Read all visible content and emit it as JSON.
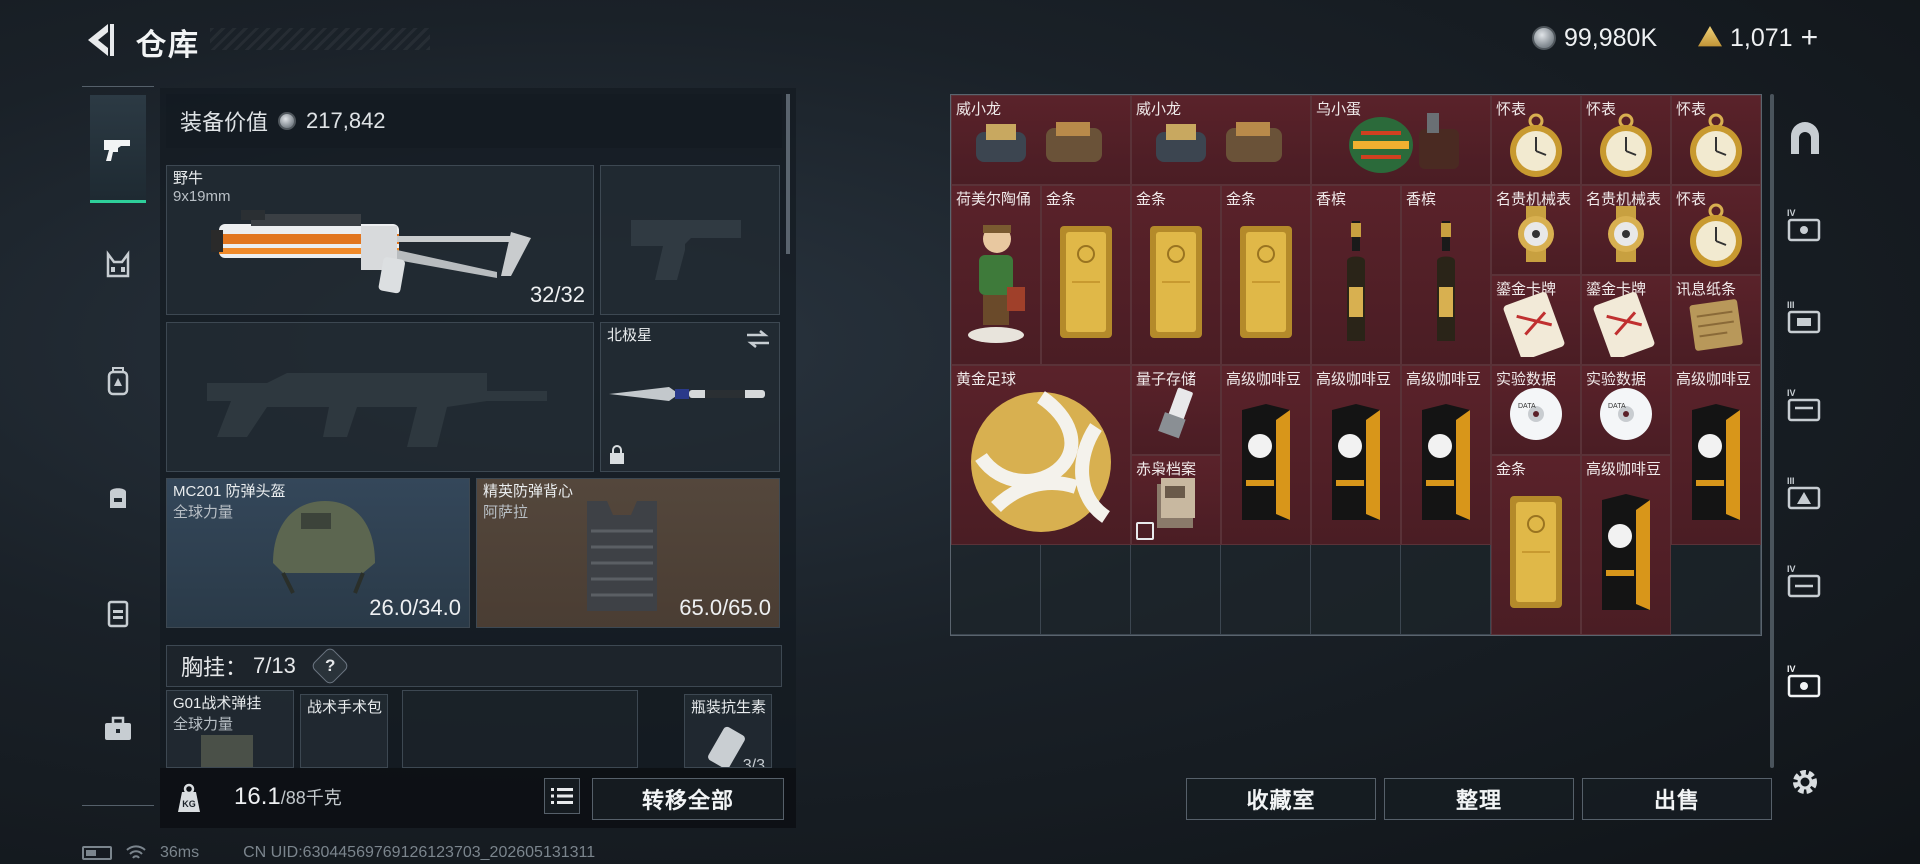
{
  "header": {
    "title": "仓库",
    "currency_silver": "99,980K",
    "currency_gold": "1,071",
    "add_symbol": "+"
  },
  "loadout": {
    "equip_value_label": "装备价值",
    "equip_value": "217,842",
    "primary": {
      "name": "野牛",
      "ammo": "9x19mm",
      "count": "32/32"
    },
    "knife": {
      "name": "北极星"
    },
    "helmet": {
      "name": "MC201 防弹头盔",
      "brand": "全球力量",
      "durability": "26.0/34.0"
    },
    "armor": {
      "name": "精英防弹背心",
      "brand": "阿萨拉",
      "durability": "65.0/65.0"
    },
    "chest_rig": {
      "label": "胸挂：",
      "count": "7/13",
      "help": "?"
    },
    "chest_items": [
      {
        "name": "G01战术弹挂",
        "brand": "全球力量"
      },
      {
        "name": "战术手术包"
      },
      {
        "name": "瓶装抗生素",
        "count": "3/3"
      }
    ]
  },
  "bottom": {
    "weight": "16.1",
    "weight_max": "/88千克",
    "transfer_all": "转移全部",
    "collection_room": "收藏室",
    "organize": "整理",
    "sell": "出售"
  },
  "stash_items": [
    {
      "name": "威小龙",
      "art": "glove"
    },
    {
      "name": "威小龙",
      "art": "glove"
    },
    {
      "name": "乌小蛋",
      "art": "egg"
    },
    {
      "name": "怀表",
      "art": "watch"
    },
    {
      "name": "怀表",
      "art": "watch"
    },
    {
      "name": "怀表",
      "art": "watch"
    },
    {
      "name": "荷美尔陶俑",
      "art": "figurine"
    },
    {
      "name": "金条",
      "art": "goldbar"
    },
    {
      "name": "金条",
      "art": "goldbar"
    },
    {
      "name": "金条",
      "art": "goldbar"
    },
    {
      "name": "香槟",
      "art": "bottle"
    },
    {
      "name": "香槟",
      "art": "bottle"
    },
    {
      "name": "名贵机械表",
      "art": "wristwatch"
    },
    {
      "name": "名贵机械表",
      "art": "wristwatch"
    },
    {
      "name": "怀表",
      "art": "watch"
    },
    {
      "name": "鎏金卡牌",
      "art": "card"
    },
    {
      "name": "鎏金卡牌",
      "art": "card"
    },
    {
      "name": "讯息纸条",
      "art": "note"
    },
    {
      "name": "黄金足球",
      "art": "ball"
    },
    {
      "name": "量子存储",
      "art": "usb"
    },
    {
      "name": "高级咖啡豆",
      "art": "coffee"
    },
    {
      "name": "高级咖啡豆",
      "art": "coffee"
    },
    {
      "name": "高级咖啡豆",
      "art": "coffee"
    },
    {
      "name": "实验数据",
      "art": "disc"
    },
    {
      "name": "实验数据",
      "art": "disc"
    },
    {
      "name": "高级咖啡豆",
      "art": "coffee"
    },
    {
      "name": "赤枭档案",
      "art": "files"
    },
    {
      "name": "金条",
      "art": "goldbar"
    },
    {
      "name": "高级咖啡豆",
      "art": "coffee"
    }
  ],
  "status": {
    "ping": "36ms",
    "uid": "CN UID:6304456976912​6123703_202605131311"
  },
  "colors": {
    "accent": "#2ecf9a",
    "item_bg": "#4a1d24",
    "armor_bg": "#4a3d33",
    "helmet_bg": "#2a3a48"
  }
}
